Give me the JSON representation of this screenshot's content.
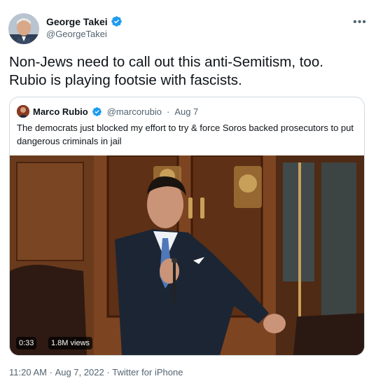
{
  "tweet": {
    "author_name": "George Takei",
    "author_handle": "@GeorgeTakei",
    "text_line1": "Non-Jews need to call out this anti-Semitism, too.",
    "text_line2": "Rubio is playing footsie with fascists.",
    "timestamp": "11:20 AM",
    "separator": "·",
    "date": "Aug 7, 2022",
    "source": "Twitter for iPhone",
    "more_label": "•••"
  },
  "quoted": {
    "author_name": "Marco Rubio",
    "author_handle": "@marcorubio",
    "separator": "·",
    "date": "Aug 7",
    "text": "The democrats just blocked my effort to try & force Soros backed prosecutors to put dangerous criminals in jail",
    "video": {
      "duration": "0:33",
      "views": "1.8M views"
    }
  },
  "colors": {
    "verified_blue": "#1d9bf0",
    "text_primary": "#0f1419",
    "text_secondary": "#536471",
    "border": "#cfd9de"
  },
  "icons": [
    "verified-badge-icon",
    "more-options-icon"
  ]
}
